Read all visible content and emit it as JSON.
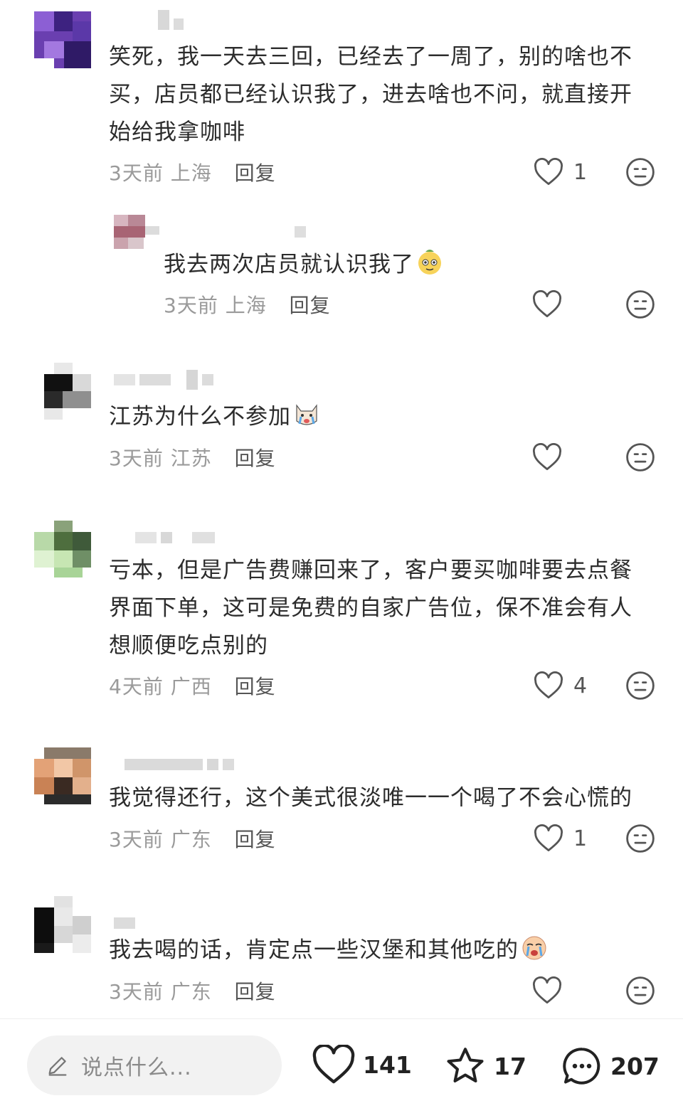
{
  "comments": [
    {
      "text_lines": [
        "笑死，我一天去三回，已经去了一周了，别的啥也不",
        "买，店员都已经认识我了，进去啥也不问，就直接开",
        "始给我拿咖啡"
      ],
      "time": "3天前",
      "location": "上海",
      "reply_label": "回复",
      "likes": "1",
      "reply": {
        "text": "我去两次店员就认识我了",
        "emoji": "cheeky-face-emoji",
        "time": "3天前",
        "location": "上海",
        "reply_label": "回复",
        "likes": ""
      }
    },
    {
      "text_lines": [
        "江苏为什么不参加"
      ],
      "emoji": "crying-dog-emoji",
      "time": "3天前",
      "location": "江苏",
      "reply_label": "回复",
      "likes": ""
    },
    {
      "text_lines": [
        "亏本，但是广告费赚回来了，客户要买咖啡要去点餐",
        "界面下单，这可是免费的自家广告位，保不准会有人",
        "想顺便吃点别的"
      ],
      "time": "4天前",
      "location": "广西",
      "reply_label": "回复",
      "likes": "4"
    },
    {
      "text_lines": [
        "我觉得还行，这个美式很淡唯一一个喝了不会心慌的"
      ],
      "time": "3天前",
      "location": "广东",
      "reply_label": "回复",
      "likes": "1"
    },
    {
      "text_lines": [
        "我去喝的话，肯定点一些汉堡和其他吃的"
      ],
      "emoji": "crying-face-emoji",
      "time": "3天前",
      "location": "广东",
      "reply_label": "回复",
      "likes": ""
    }
  ],
  "bottom_bar": {
    "input_placeholder": "说点什么...",
    "likes": "141",
    "stars": "17",
    "comments": "207"
  },
  "colors": {
    "meta_text": "#9a9a9a",
    "body_text": "#2c2c2c",
    "input_bg": "#f2f2f2"
  }
}
